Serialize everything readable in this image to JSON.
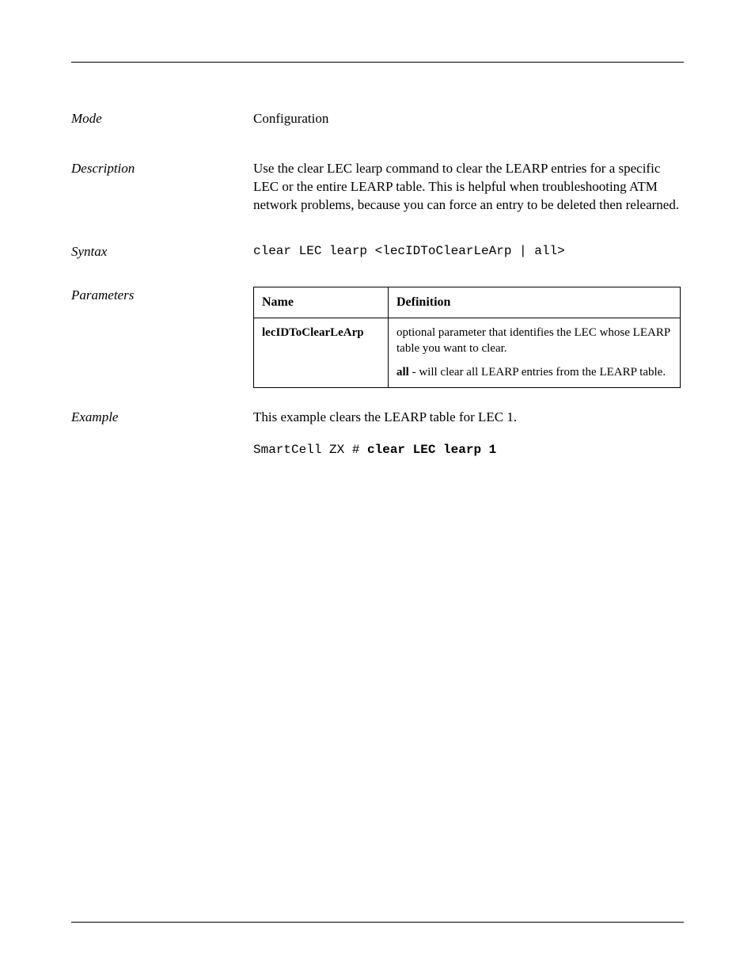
{
  "sections": {
    "mode": {
      "label": "Mode",
      "value": "Configuration"
    },
    "description": {
      "label": "Description",
      "value": "Use the clear LEC learp command to clear the LEARP entries for a specific LEC or the entire LEARP table. This is helpful when troubleshooting ATM network problems, because you can force an entry to be deleted then relearned."
    },
    "syntax": {
      "label": "Syntax",
      "command": "clear LEC learp <lecIDToClearLeArp | all>"
    },
    "parameters": {
      "label": "Parameters",
      "headers": {
        "name": "Name",
        "definition": "Definition"
      },
      "rows": [
        {
          "name": "lecIDToClearLeArp",
          "def_line1": "optional parameter that identifies the LEC whose LEARP table you want to clear.",
          "def_line2_bold": "all",
          "def_line2_rest": " - will clear all LEARP entries from the LEARP table."
        }
      ]
    },
    "example": {
      "label": "Example",
      "intro": "This example clears the LEARP table for LEC 1.",
      "prompt": "SmartCell ZX #",
      "command": " clear LEC learp 1"
    }
  }
}
